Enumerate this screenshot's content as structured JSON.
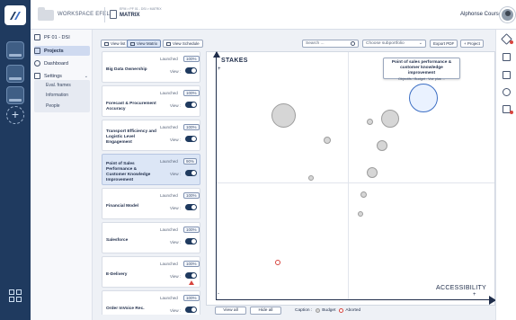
{
  "workspace": {
    "name": "WORKSPACE EFEL"
  },
  "breadcrumb": {
    "path": "EFM > PF 01 - DSI > MATRIX",
    "page": "MATRIX"
  },
  "user": {
    "name": "Alphonse Course"
  },
  "project_nav": {
    "project_title": "PF 01 - DSI",
    "items": [
      {
        "label": "Projects",
        "icon": "folder-icon",
        "active": true
      },
      {
        "label": "Dashboard",
        "icon": "dashboard-icon",
        "active": false
      },
      {
        "label": "Settings",
        "icon": "settings-icon",
        "active": false
      }
    ],
    "settings_sub": [
      "Eval. frames",
      "Information",
      "People"
    ]
  },
  "toolbar": {
    "view_list": "View list",
    "view_matrix": "View Matrix",
    "view_schedule": "View Schedule",
    "search_placeholder": "Search ...",
    "subportfolio_placeholder": "Choose subportfolio",
    "export_pdf": "Export PDF",
    "add_project": "+ Project"
  },
  "projects": [
    {
      "name": "Big Data Ownership",
      "launched": "Launched",
      "pct": "100%",
      "view": "View :"
    },
    {
      "name": "Forecast & Procurement Accuracy",
      "launched": "Launched",
      "pct": "100%",
      "view": "View :"
    },
    {
      "name": "Transport Efficiency and Logistic Level Engagement",
      "launched": "Launched",
      "pct": "100%",
      "view": "View :"
    },
    {
      "name": "Point of Sales Performance & Customer Knowledge Improvement",
      "launched": "Launched",
      "pct": "90%",
      "view": "View :"
    },
    {
      "name": "Financial Model",
      "launched": "Launched",
      "pct": "100%",
      "view": "View :"
    },
    {
      "name": "Salesforce",
      "launched": "Launched",
      "pct": "100%",
      "view": "View :"
    },
    {
      "name": "E-Delivery",
      "launched": "Launched",
      "pct": "100%",
      "view": "View :"
    },
    {
      "name": "Order InVoice Rec.",
      "launched": "Launched",
      "pct": "100%",
      "view": "View :"
    }
  ],
  "matrix": {
    "y_axis": "STAKES",
    "x_axis": "ACCESSIBILITY",
    "plus": "+",
    "minus": "-",
    "tooltip": {
      "title": "Point of sales performance & customer knowledge improvement",
      "sub": "Objectifs / Budget : Voir plus ..."
    }
  },
  "footer": {
    "view_all": "View all",
    "hide_all": "Hide all",
    "caption": "Caption :",
    "budget": "Budget",
    "aborted": "Aborted"
  },
  "colors": {
    "brand": "#1f3a5f",
    "accent": "#3d6fc4",
    "alert": "#d7443e"
  }
}
